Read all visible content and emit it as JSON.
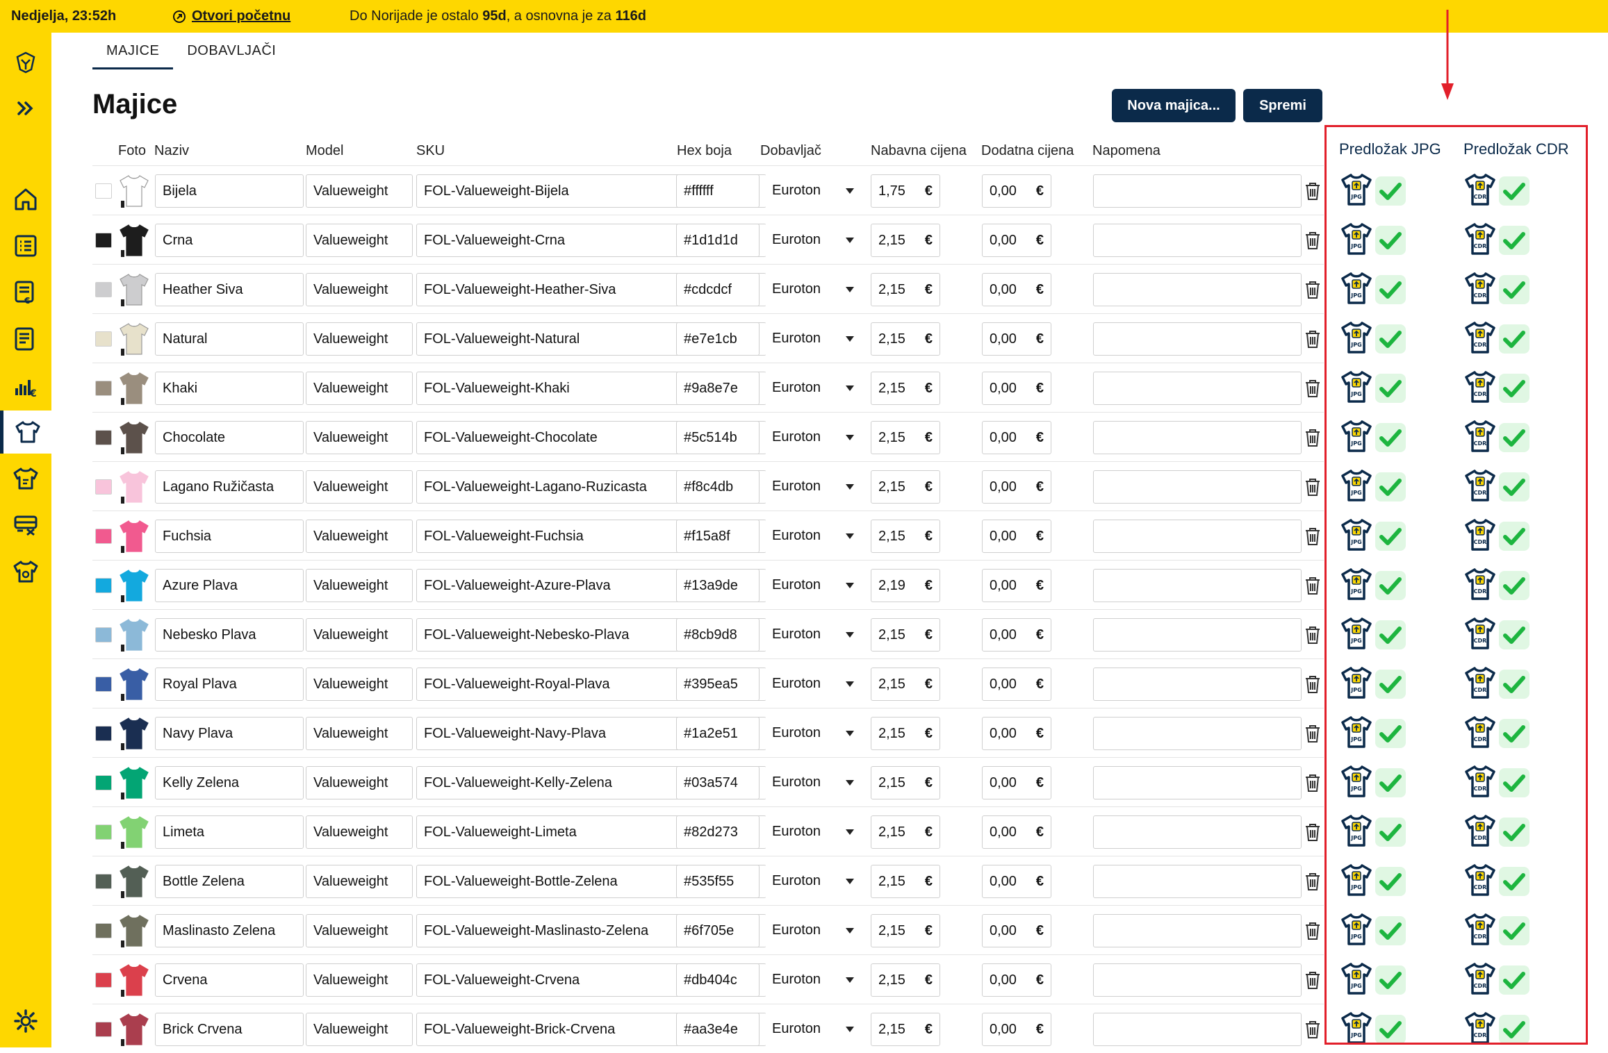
{
  "topbar": {
    "clock": "Nedjelja, 23:52h",
    "link": "Otvori početnu",
    "countdown_pre": "Do Norijade je ostalo ",
    "countdown_days1": "95d",
    "countdown_mid": ", a osnovna je za ",
    "countdown_days2": "116d"
  },
  "tabs": [
    "MAJICE",
    "DOBAVLJAČI"
  ],
  "page": {
    "title": "Majice",
    "new_button": "Nova majica...",
    "save_button": "Spremi"
  },
  "columns": {
    "photo": "Foto",
    "name": "Naziv",
    "model": "Model",
    "sku": "SKU",
    "hex": "Hex boja",
    "supplier": "Dobavljač",
    "price": "Nabavna cijena",
    "extra": "Dodatna cijena",
    "note": "Napomena",
    "tpl_jpg": "Predložak JPG",
    "tpl_cdr": "Predložak CDR"
  },
  "currency": "€",
  "rows": [
    {
      "name": "Bijela",
      "model": "Valueweight",
      "sku": "FOL-Valueweight-Bijela",
      "hex": "#ffffff",
      "supplier": "Euroton",
      "price": "1,75",
      "extra": "0,00",
      "note": ""
    },
    {
      "name": "Crna",
      "model": "Valueweight",
      "sku": "FOL-Valueweight-Crna",
      "hex": "#1d1d1d",
      "supplier": "Euroton",
      "price": "2,15",
      "extra": "0,00",
      "note": ""
    },
    {
      "name": "Heather Siva",
      "model": "Valueweight",
      "sku": "FOL-Valueweight-Heather-Siva",
      "hex": "#cdcdcf",
      "supplier": "Euroton",
      "price": "2,15",
      "extra": "0,00",
      "note": ""
    },
    {
      "name": "Natural",
      "model": "Valueweight",
      "sku": "FOL-Valueweight-Natural",
      "hex": "#e7e1cb",
      "supplier": "Euroton",
      "price": "2,15",
      "extra": "0,00",
      "note": ""
    },
    {
      "name": "Khaki",
      "model": "Valueweight",
      "sku": "FOL-Valueweight-Khaki",
      "hex": "#9a8e7e",
      "supplier": "Euroton",
      "price": "2,15",
      "extra": "0,00",
      "note": ""
    },
    {
      "name": "Chocolate",
      "model": "Valueweight",
      "sku": "FOL-Valueweight-Chocolate",
      "hex": "#5c514b",
      "supplier": "Euroton",
      "price": "2,15",
      "extra": "0,00",
      "note": ""
    },
    {
      "name": "Lagano Ružičasta",
      "model": "Valueweight",
      "sku": "FOL-Valueweight-Lagano-Ruzicasta",
      "hex": "#f8c4db",
      "supplier": "Euroton",
      "price": "2,15",
      "extra": "0,00",
      "note": ""
    },
    {
      "name": "Fuchsia",
      "model": "Valueweight",
      "sku": "FOL-Valueweight-Fuchsia",
      "hex": "#f15a8f",
      "supplier": "Euroton",
      "price": "2,15",
      "extra": "0,00",
      "note": ""
    },
    {
      "name": "Azure Plava",
      "model": "Valueweight",
      "sku": "FOL-Valueweight-Azure-Plava",
      "hex": "#13a9de",
      "supplier": "Euroton",
      "price": "2,19",
      "extra": "0,00",
      "note": ""
    },
    {
      "name": "Nebesko Plava",
      "model": "Valueweight",
      "sku": "FOL-Valueweight-Nebesko-Plava",
      "hex": "#8cb9d8",
      "supplier": "Euroton",
      "price": "2,15",
      "extra": "0,00",
      "note": ""
    },
    {
      "name": "Royal Plava",
      "model": "Valueweight",
      "sku": "FOL-Valueweight-Royal-Plava",
      "hex": "#395ea5",
      "supplier": "Euroton",
      "price": "2,15",
      "extra": "0,00",
      "note": ""
    },
    {
      "name": "Navy Plava",
      "model": "Valueweight",
      "sku": "FOL-Valueweight-Navy-Plava",
      "hex": "#1a2e51",
      "supplier": "Euroton",
      "price": "2,15",
      "extra": "0,00",
      "note": ""
    },
    {
      "name": "Kelly Zelena",
      "model": "Valueweight",
      "sku": "FOL-Valueweight-Kelly-Zelena",
      "hex": "#03a574",
      "supplier": "Euroton",
      "price": "2,15",
      "extra": "0,00",
      "note": ""
    },
    {
      "name": "Limeta",
      "model": "Valueweight",
      "sku": "FOL-Valueweight-Limeta",
      "hex": "#82d273",
      "supplier": "Euroton",
      "price": "2,15",
      "extra": "0,00",
      "note": ""
    },
    {
      "name": "Bottle Zelena",
      "model": "Valueweight",
      "sku": "FOL-Valueweight-Bottle-Zelena",
      "hex": "#535f55",
      "supplier": "Euroton",
      "price": "2,15",
      "extra": "0,00",
      "note": ""
    },
    {
      "name": "Maslinasto Zelena",
      "model": "Valueweight",
      "sku": "FOL-Valueweight-Maslinasto-Zelena",
      "hex": "#6f705e",
      "supplier": "Euroton",
      "price": "2,15",
      "extra": "0,00",
      "note": ""
    },
    {
      "name": "Crvena",
      "model": "Valueweight",
      "sku": "FOL-Valueweight-Crvena",
      "hex": "#db404c",
      "supplier": "Euroton",
      "price": "2,15",
      "extra": "0,00",
      "note": ""
    },
    {
      "name": "Brick Crvena",
      "model": "Valueweight",
      "sku": "FOL-Valueweight-Brick-Crvena",
      "hex": "#aa3e4e",
      "supplier": "Euroton",
      "price": "2,15",
      "extra": "0,00",
      "note": ""
    }
  ],
  "template_labels": {
    "jpg": "JPG",
    "cdr": "CDR"
  },
  "colors": {
    "accent": "#fed700",
    "primary": "#0b2a4a",
    "highlight": "#e21f2a",
    "check": "#1db53f"
  },
  "icons": {
    "sidebar": [
      "logo-icon",
      "expand-icon",
      "home-icon",
      "list-icon",
      "invoice-icon",
      "document-icon",
      "sales-chart-icon",
      "tshirt-icon",
      "tshirt-edit-icon",
      "delivery-icon",
      "tshirt-settings-icon",
      "settings-gear-icon"
    ]
  }
}
